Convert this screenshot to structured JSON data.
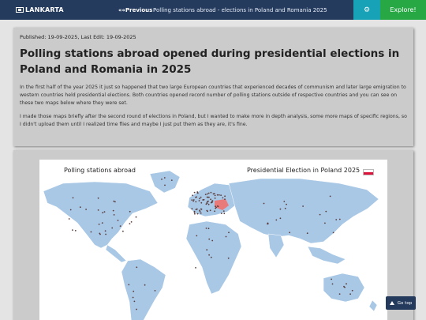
{
  "nav": {
    "brand": "LANKARTA",
    "prev_label": "««Previous",
    "prev_title": "Polling stations abroad - elections in Poland and Romania 2025",
    "settings_icon": "gear-icon",
    "explore_label": "Explore!"
  },
  "article": {
    "meta": "Published: 19-09-2025, Last Edit: 19-09-2025",
    "title": "Polling stations abroad opened during presidential elections in Poland and Romania in 2025",
    "paragraphs": [
      "In the first half of the year 2025 it just so happened that two large European countries that experienced decades of communism and later large emigration to western countries held presidential elections. Both countries opened record number of polling stations outside of respective countries and you can see on these two maps below where they were set.",
      "I made those maps briefly after the second round of elections in Poland, but I wanted to make more in depth analysis, some more maps of specific regions, so I didn't upload them until I realized time flies and maybe I just put them as they are, it's fine."
    ]
  },
  "map": {
    "title_left": "Polling stations abroad",
    "title_right": "Presidential Election in Poland 2025",
    "flag_colors": [
      "#ffffff",
      "#dc143c"
    ],
    "land_color": "#a9c8e6",
    "highlight_color": "#e87a7a",
    "dot_color": "#5a3c3c"
  },
  "gotop": {
    "label": "Go top",
    "icon": "arrow-up-icon"
  }
}
